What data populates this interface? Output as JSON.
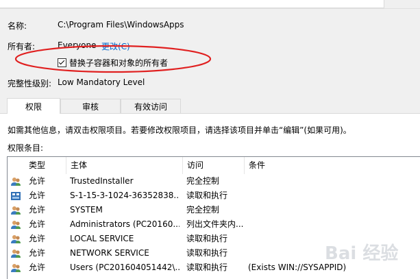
{
  "fields": {
    "name_label": "名称:",
    "name_value": "C:\\Program Files\\WindowsApps",
    "owner_label": "所有者:",
    "owner_value": "Everyone",
    "owner_change_link": "更改(C)",
    "replace_owner_checkbox": "替换子容器和对象的所有者",
    "replace_owner_checked": true,
    "integrity_label": "完整性级别:",
    "integrity_value": "Low Mandatory Level"
  },
  "tabs": [
    {
      "label": "权限",
      "active": true
    },
    {
      "label": "审核",
      "active": false
    },
    {
      "label": "有效访问",
      "active": false
    }
  ],
  "info_text": "如需其他信息，请双击权限项目。若要修改权限项目，请选择该项目并单击“编辑”(如果可用)。",
  "entries_label": "权限条目:",
  "table": {
    "columns": [
      "类型",
      "主体",
      "访问",
      "条件"
    ],
    "rows": [
      {
        "icon": "users-icon",
        "type": "允许",
        "principal": "TrustedInstaller",
        "access": "完全控制",
        "condition": ""
      },
      {
        "icon": "app-package-icon",
        "type": "允许",
        "principal": "S-1-15-3-1024-36352838...",
        "access": "读取和执行",
        "condition": ""
      },
      {
        "icon": "users-icon",
        "type": "允许",
        "principal": "SYSTEM",
        "access": "完全控制",
        "condition": ""
      },
      {
        "icon": "users-icon",
        "type": "允许",
        "principal": "Administrators (PC20160...",
        "access": "列出文件夹内...",
        "condition": ""
      },
      {
        "icon": "users-icon",
        "type": "允许",
        "principal": "LOCAL SERVICE",
        "access": "读取和执行",
        "condition": ""
      },
      {
        "icon": "users-icon",
        "type": "允许",
        "principal": "NETWORK SERVICE",
        "access": "读取和执行",
        "condition": ""
      },
      {
        "icon": "users-icon",
        "type": "允许",
        "principal": "Users (PC201604051442\\...",
        "access": "读取和执行",
        "condition": "(Exists WIN://SYSAPPID)"
      }
    ]
  },
  "colors": {
    "link": "#0066cc",
    "highlight_ellipse": "#e02020"
  },
  "watermark_text": "Bai 经验"
}
